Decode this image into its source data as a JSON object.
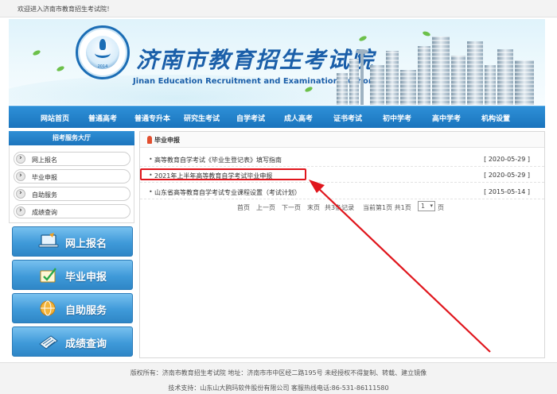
{
  "topbar": {
    "welcome": "欢迎进入济南市教育招生考试院！"
  },
  "banner": {
    "title_cn": "济南市教育招生考试院",
    "title_en": "Jinan Education Recruitment and Examination Authority",
    "logo_year": "2014"
  },
  "nav": {
    "items": [
      "网站首页",
      "普通高考",
      "普通专升本",
      "研究生考试",
      "自学考试",
      "成人高考",
      "证书考试",
      "初中学考",
      "高中学考",
      "机构设置"
    ]
  },
  "sidebar": {
    "header": "招考服务大厅",
    "links": [
      "网上报名",
      "毕业申报",
      "自助服务",
      "成绩查询"
    ],
    "buttons": [
      "网上报名",
      "毕业申报",
      "自助服务",
      "成绩查询"
    ]
  },
  "panel": {
    "title": "毕业申报",
    "rows": [
      {
        "title": "高等教育自学考试《毕业生登记表》填写指南",
        "date": "[ 2020-05-29 ]"
      },
      {
        "title": "2021年上半年高等教育自学考试毕业申报",
        "date": "[ 2020-05-29 ]"
      },
      {
        "title": "山东省高等教育自学考试专业课程设置（考试计划）",
        "date": "[ 2015-05-14 ]"
      }
    ],
    "pager": {
      "first": "首页",
      "prev": "上一页",
      "next": "下一页",
      "last": "末页",
      "total": "共3条记录",
      "current": "当前第1页 共1页",
      "select_value": "1",
      "suffix": "页"
    }
  },
  "footer": {
    "line1": "版权所有：济南市教育招生考试院 地址：济南市市中区经二路195号 未经授权不得复制、转载、建立镜像",
    "line2": "技术支持：山东山大鸥玛软件股份有限公司 客服热线电话:86-531-86111580"
  },
  "colors": {
    "nav_bg": "#1a74bd",
    "accent": "#e0161d",
    "brand": "#1b5fa9"
  }
}
